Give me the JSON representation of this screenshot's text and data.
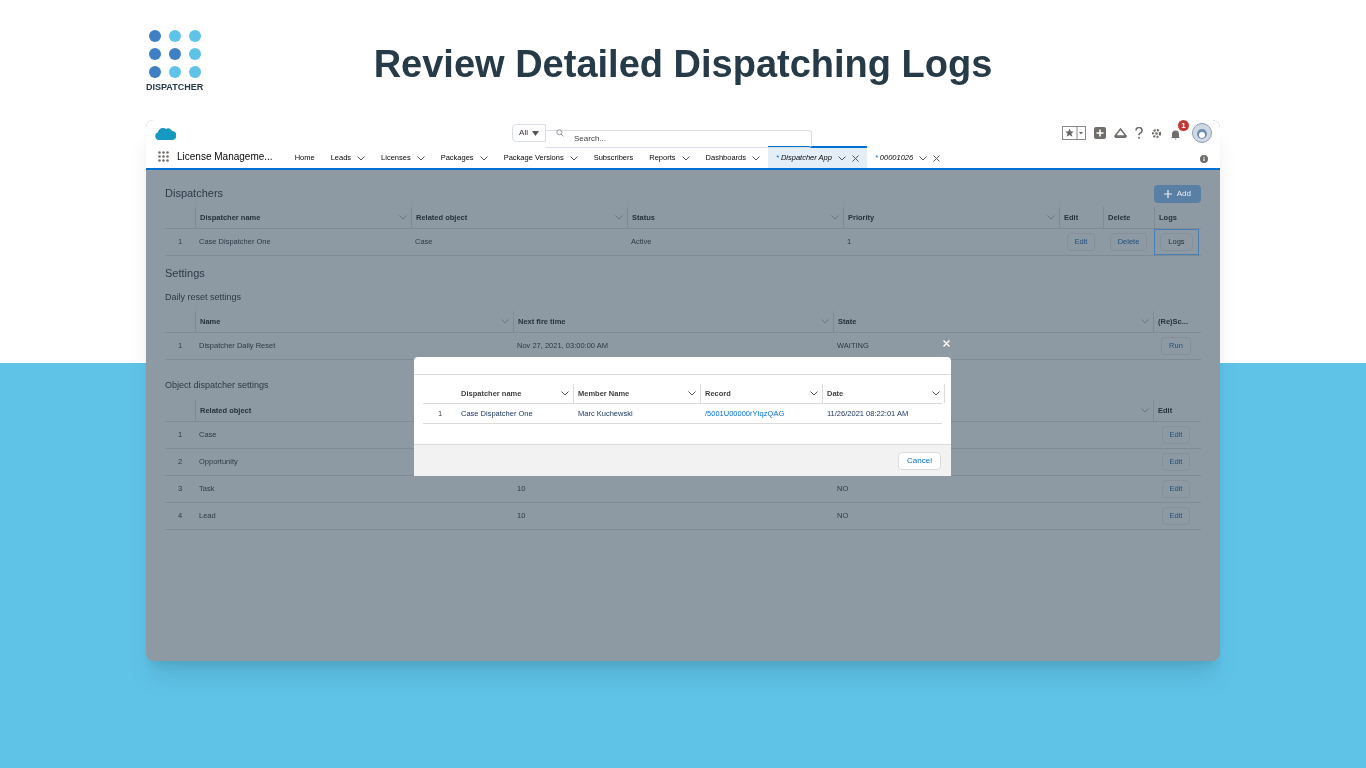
{
  "slide": {
    "logo_text": "DISPATCHER",
    "title": "Review Detailed Dispatching Logs"
  },
  "header": {
    "search_scope": "All",
    "search_placeholder": "Search...",
    "notification_count": "1"
  },
  "nav": {
    "app_name": "License Manageme...",
    "items": [
      {
        "kind": "nav",
        "label": "Home",
        "dropdown": false,
        "selected": false
      },
      {
        "kind": "nav",
        "label": "Leads",
        "dropdown": true,
        "selected": false
      },
      {
        "kind": "nav",
        "label": "Licenses",
        "dropdown": true,
        "selected": false
      },
      {
        "kind": "nav",
        "label": "Packages",
        "dropdown": true,
        "selected": false
      },
      {
        "kind": "nav",
        "label": "Package Versions",
        "dropdown": true,
        "selected": false
      },
      {
        "kind": "nav",
        "label": "Subscribers",
        "dropdown": false,
        "selected": false
      },
      {
        "kind": "nav",
        "label": "Reports",
        "dropdown": true,
        "selected": false
      },
      {
        "kind": "nav",
        "label": "Dashboards",
        "dropdown": true,
        "selected": false
      },
      {
        "kind": "tab",
        "marker": "*",
        "label": "Dispatcher App",
        "dropdown": true,
        "selected": true
      },
      {
        "kind": "tab",
        "marker": "*",
        "label": "00001026",
        "dropdown": true,
        "selected": false
      }
    ]
  },
  "dispatchers": {
    "title": "Dispatchers",
    "add_button": "Add",
    "columns": [
      {
        "label": "Dispatcher name",
        "sortable": true
      },
      {
        "label": "Related object",
        "sortable": true
      },
      {
        "label": "Status",
        "sortable": true
      },
      {
        "label": "Priority",
        "sortable": true
      },
      {
        "label": "Edit",
        "sortable": false
      },
      {
        "label": "Delete",
        "sortable": false
      },
      {
        "label": "Logs",
        "sortable": false
      }
    ],
    "rows": [
      {
        "number": "1",
        "cells": [
          "Case Dispatcher One",
          "Case",
          "Active",
          "1"
        ],
        "actions": [
          {
            "label": "Edit",
            "focused": false
          },
          {
            "label": "Delete",
            "focused": false
          },
          {
            "label": "Logs",
            "focused": true
          }
        ]
      }
    ]
  },
  "settings": {
    "title": "Settings",
    "daily_reset": {
      "title": "Daily reset settings",
      "columns": [
        {
          "label": "Name",
          "sortable": true
        },
        {
          "label": "Next fire time",
          "sortable": true
        },
        {
          "label": "State",
          "sortable": true
        },
        {
          "label": "(Re)Sc...",
          "sortable": false
        }
      ],
      "rows": [
        {
          "number": "1",
          "cells": [
            "Dispatcher Daily Reset",
            "Nov 27, 2021, 03:00:00 AM",
            "WAITING"
          ],
          "actions": [
            {
              "label": "Run",
              "focused": false
            }
          ]
        }
      ]
    },
    "object_dispatcher": {
      "title": "Object dispatcher settings",
      "columns": [
        {
          "label": "Related object"
        },
        {},
        {
          "sortable": true
        },
        {
          "label": "Edit",
          "sortable": false
        }
      ],
      "rows": [
        {
          "number": "1",
          "cells": [
            "Case",
            null,
            null
          ],
          "actions": [
            {
              "label": "Edit",
              "focused": false
            }
          ]
        },
        {
          "number": "2",
          "cells": [
            "Opportunity",
            null,
            null
          ],
          "actions": [
            {
              "label": "Edit",
              "focused": false
            }
          ]
        },
        {
          "number": "3",
          "cells": [
            "Task",
            "10",
            "NO"
          ],
          "actions": [
            {
              "label": "Edit",
              "focused": false
            }
          ]
        },
        {
          "number": "4",
          "cells": [
            "Lead",
            "10",
            "NO"
          ],
          "actions": [
            {
              "label": "Edit",
              "focused": false
            }
          ]
        }
      ]
    }
  },
  "modal": {
    "columns": [
      "Dispatcher name",
      "Member Name",
      "Record",
      "Date"
    ],
    "rows": [
      {
        "number": "1",
        "cells": [
          {
            "kind": "text",
            "text": "Case Dispatcher One"
          },
          {
            "kind": "text",
            "text": "Marc Kuchewski"
          },
          {
            "kind": "link",
            "text": "/5001U00000rYIqzQAG"
          },
          {
            "kind": "text",
            "text": "11/26/2021 08:22:01 AM"
          }
        ]
      }
    ],
    "cancel_button": "Cancel"
  }
}
